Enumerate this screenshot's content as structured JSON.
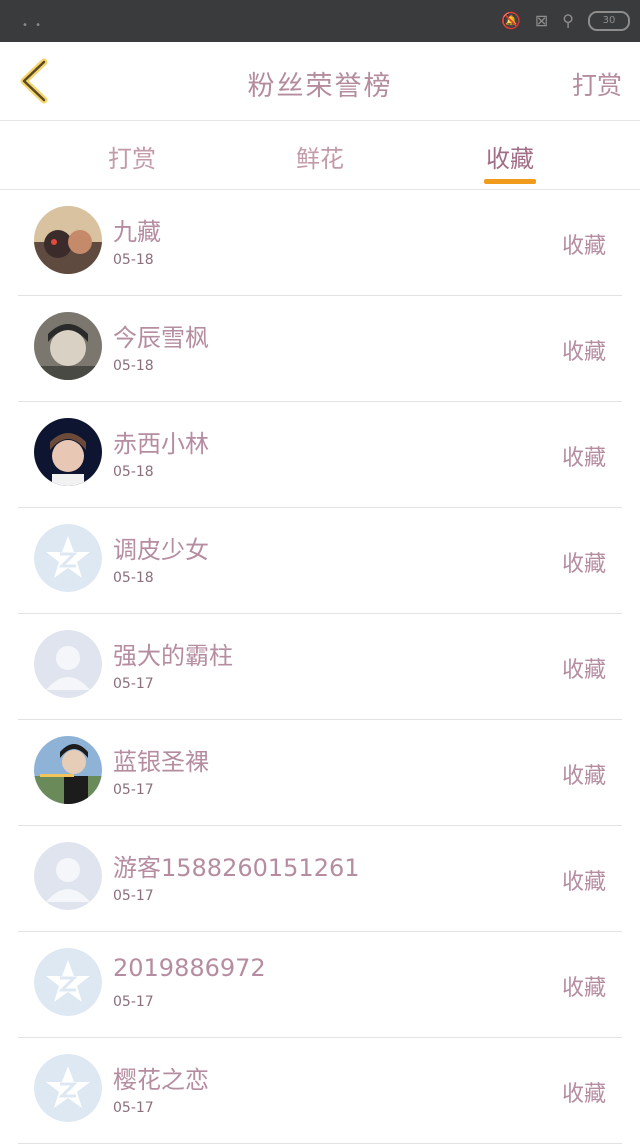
{
  "header": {
    "title": "粉丝荣誉榜",
    "right_action": "打赏"
  },
  "tabs": [
    {
      "label": "打赏"
    },
    {
      "label": "鲜花"
    },
    {
      "label": "收藏"
    }
  ],
  "list": [
    {
      "name": "九藏",
      "date": "05-18",
      "action": "收藏",
      "avatar": "cartoon-photo"
    },
    {
      "name": "今辰雪枫",
      "date": "05-18",
      "action": "收藏",
      "avatar": "anime-face"
    },
    {
      "name": "赤西小林",
      "date": "05-18",
      "action": "收藏",
      "avatar": "portrait-photo"
    },
    {
      "name": "调皮少女",
      "date": "05-18",
      "action": "收藏",
      "avatar": "default-star"
    },
    {
      "name": "强大的霸柱",
      "date": "05-17",
      "action": "收藏",
      "avatar": "default-person"
    },
    {
      "name": "蓝银圣裸",
      "date": "05-17",
      "action": "收藏",
      "avatar": "costume-photo"
    },
    {
      "name": "游客1588260151261",
      "date": "05-17",
      "action": "收藏",
      "avatar": "default-person"
    },
    {
      "name": "2019886972",
      "date": "05-17",
      "action": "收藏",
      "avatar": "default-star"
    },
    {
      "name": "樱花之恋",
      "date": "05-17",
      "action": "收藏",
      "avatar": "default-star"
    }
  ],
  "colors": {
    "text_pink": "#b68da0",
    "tab_underline": "#f19b1d",
    "status_bar": "#3a3b3d"
  }
}
